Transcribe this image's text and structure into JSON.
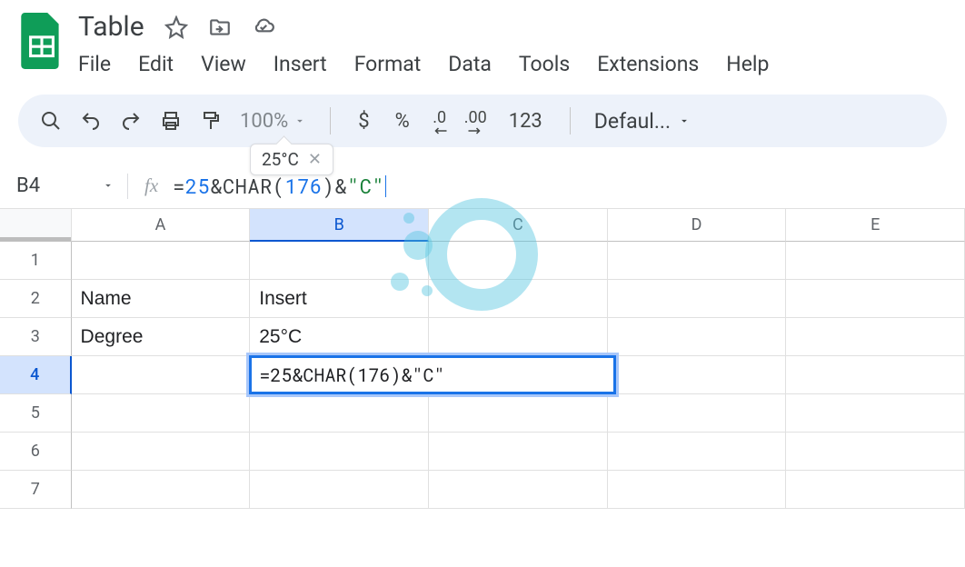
{
  "doc_title": "Table",
  "menus": [
    "File",
    "Edit",
    "View",
    "Insert",
    "Format",
    "Data",
    "Tools",
    "Extensions",
    "Help"
  ],
  "toolbar": {
    "zoom": "100%",
    "currency": "$",
    "percent": "%",
    "dec_decrease": ".0",
    "dec_increase": ".00",
    "num_format": "123",
    "font": "Defaul..."
  },
  "formula_tooltip": "25°C",
  "name_box": "B4",
  "formula": {
    "raw": "=25 & CHAR(176) & \"C\"",
    "parts": [
      {
        "t": "eq",
        "v": "="
      },
      {
        "t": "num",
        "v": "25"
      },
      {
        "t": "op",
        "v": " & "
      },
      {
        "t": "fn",
        "v": "CHAR"
      },
      {
        "t": "par",
        "v": "("
      },
      {
        "t": "num",
        "v": "176"
      },
      {
        "t": "par",
        "v": ")"
      },
      {
        "t": "op",
        "v": " & "
      },
      {
        "t": "str",
        "v": "\"C\""
      }
    ]
  },
  "columns": [
    "A",
    "B",
    "C",
    "D",
    "E"
  ],
  "selected_col": 1,
  "rows": [
    "1",
    "2",
    "3",
    "4",
    "5",
    "6",
    "7"
  ],
  "selected_row": 3,
  "cells": {
    "A2": "Name",
    "B2": "Insert",
    "A3": "Degree",
    "B3": "25°C",
    "B4_editing": "=25 & CHAR(176) & \"C\""
  },
  "chart_data": {
    "type": "table",
    "columns": [
      "A",
      "B"
    ],
    "rows": [
      {
        "A": "Name",
        "B": "Insert"
      },
      {
        "A": "Degree",
        "B": "25°C"
      }
    ]
  }
}
